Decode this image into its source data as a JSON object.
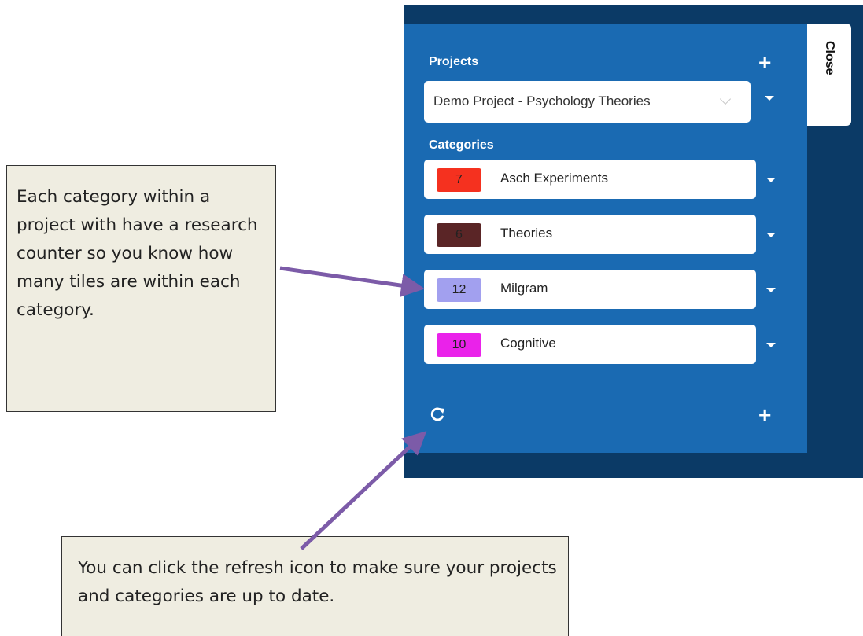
{
  "panel": {
    "close_label": "Close",
    "projects_title": "Projects",
    "project_select_value": "Demo Project - Psychology Theories",
    "categories_title": "Categories",
    "categories": [
      {
        "count": "7",
        "name": "Asch Experiments",
        "color": "#f5311f"
      },
      {
        "count": "6",
        "name": "Theories",
        "color": "#5a2526"
      },
      {
        "count": "12",
        "name": "Milgram",
        "color": "#a2a0ef"
      },
      {
        "count": "10",
        "name": "Cognitive",
        "color": "#ea22ea"
      }
    ],
    "icons": {
      "add_project": "plus-icon",
      "add_category": "plus-icon",
      "refresh": "refresh-icon",
      "caret": "caret-down-icon"
    },
    "colors": {
      "panel_dark": "#0b3a66",
      "panel": "#1a6ab2",
      "arrow": "#7c5ba8"
    }
  },
  "callouts": {
    "category_counter": "Each category within a project with have a research counter so you know how many tiles are within each category.",
    "refresh": "You can click the refresh icon to make sure your projects and categories are up to date."
  }
}
